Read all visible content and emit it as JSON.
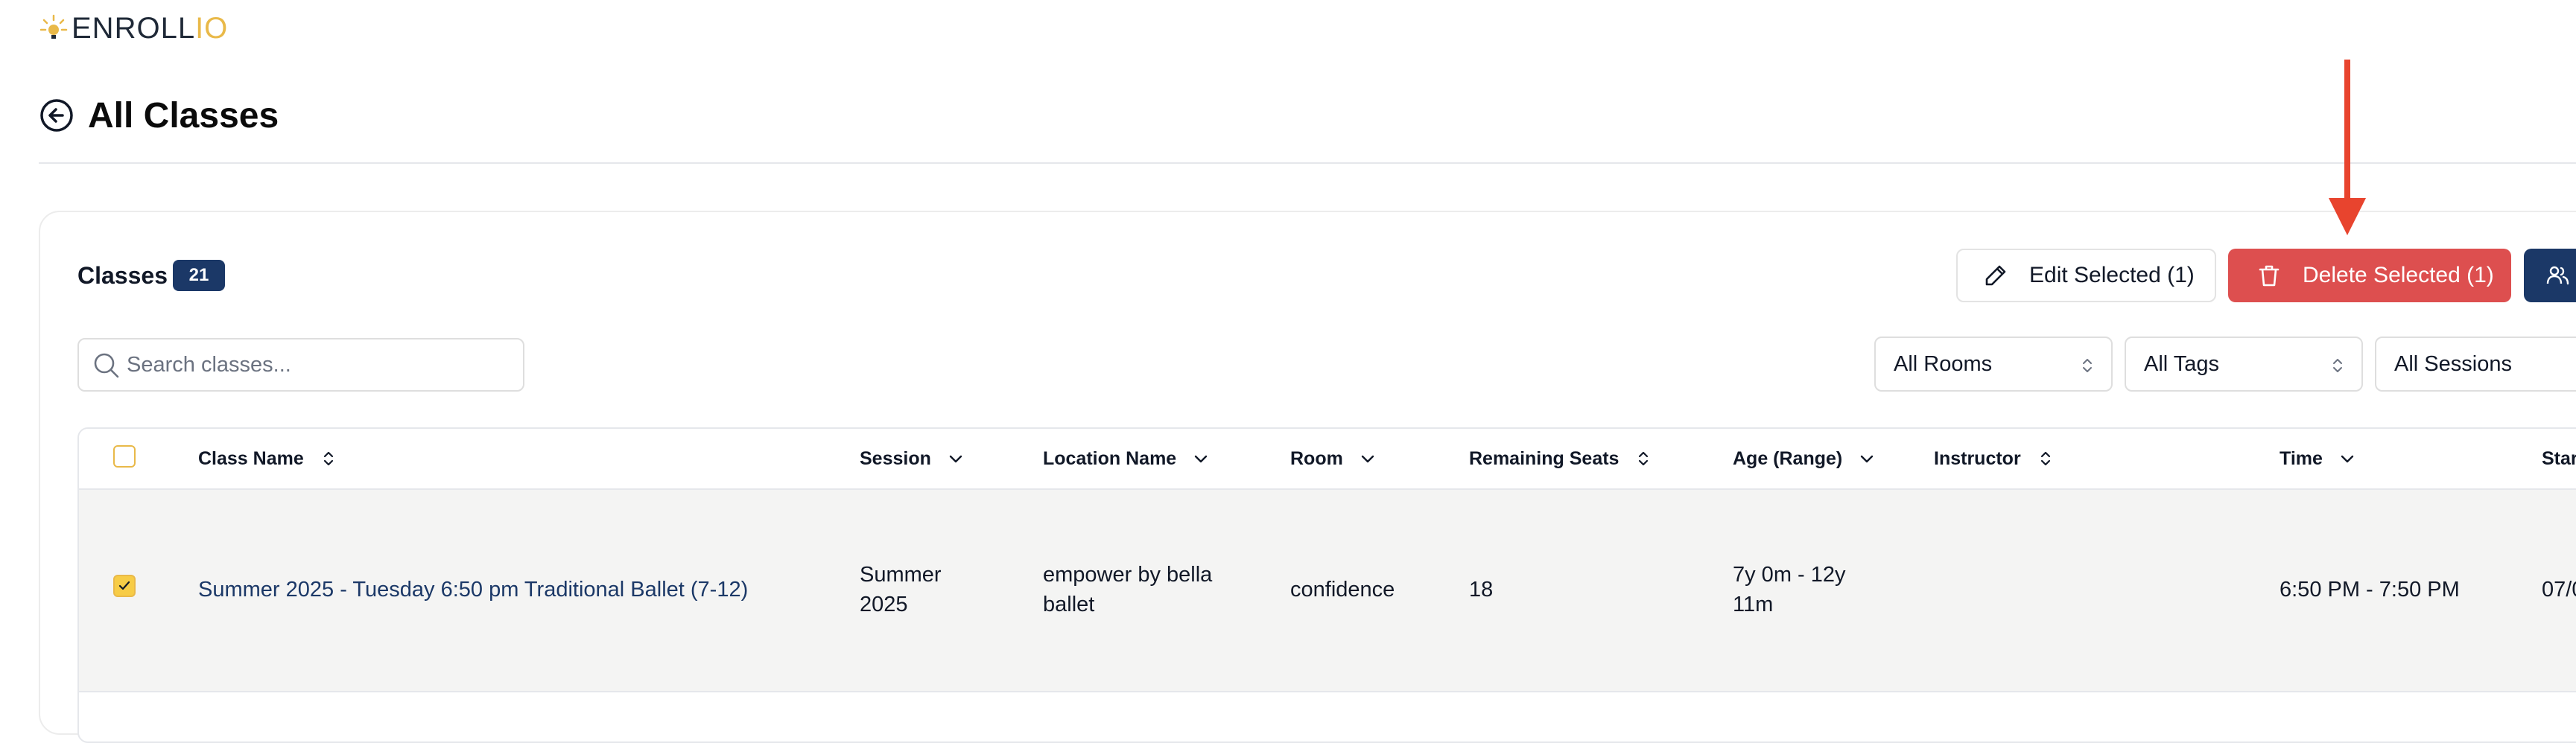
{
  "brand": {
    "part1": "ENROLL",
    "part2": "IO"
  },
  "header": {
    "title": "All Classes"
  },
  "classes": {
    "label": "Classes",
    "count": "21"
  },
  "toolbar": {
    "edit_label": "Edit Selected (1)",
    "delete_label": "Delete Selected (1)"
  },
  "search": {
    "placeholder": "Search classes..."
  },
  "filters": {
    "rooms": "All Rooms",
    "tags": "All Tags",
    "sessions": "All Sessions"
  },
  "table": {
    "columns": {
      "class_name": "Class Name",
      "session": "Session",
      "location": "Location Name",
      "room": "Room",
      "remaining": "Remaining Seats",
      "age": "Age (Range)",
      "instructor": "Instructor",
      "time": "Time",
      "start": "Star"
    },
    "rows": [
      {
        "checked": true,
        "class_name": "Summer 2025 - Tuesday 6:50 pm Traditional Ballet (7-12)",
        "session_line1": "Summer",
        "session_line2": "2025",
        "location_line1": "empower by bella",
        "location_line2": "ballet",
        "room": "confidence",
        "remaining": "18",
        "age_line1": "7y 0m - 12y",
        "age_line2": "11m",
        "instructor": "",
        "time": "6:50 PM - 7:50 PM",
        "start": "07/0"
      }
    ]
  },
  "colors": {
    "brand_navy": "#1b3867",
    "danger": "#dd4f4f",
    "accent_yellow": "#e9b949",
    "annotation_arrow": "#e8442e"
  }
}
